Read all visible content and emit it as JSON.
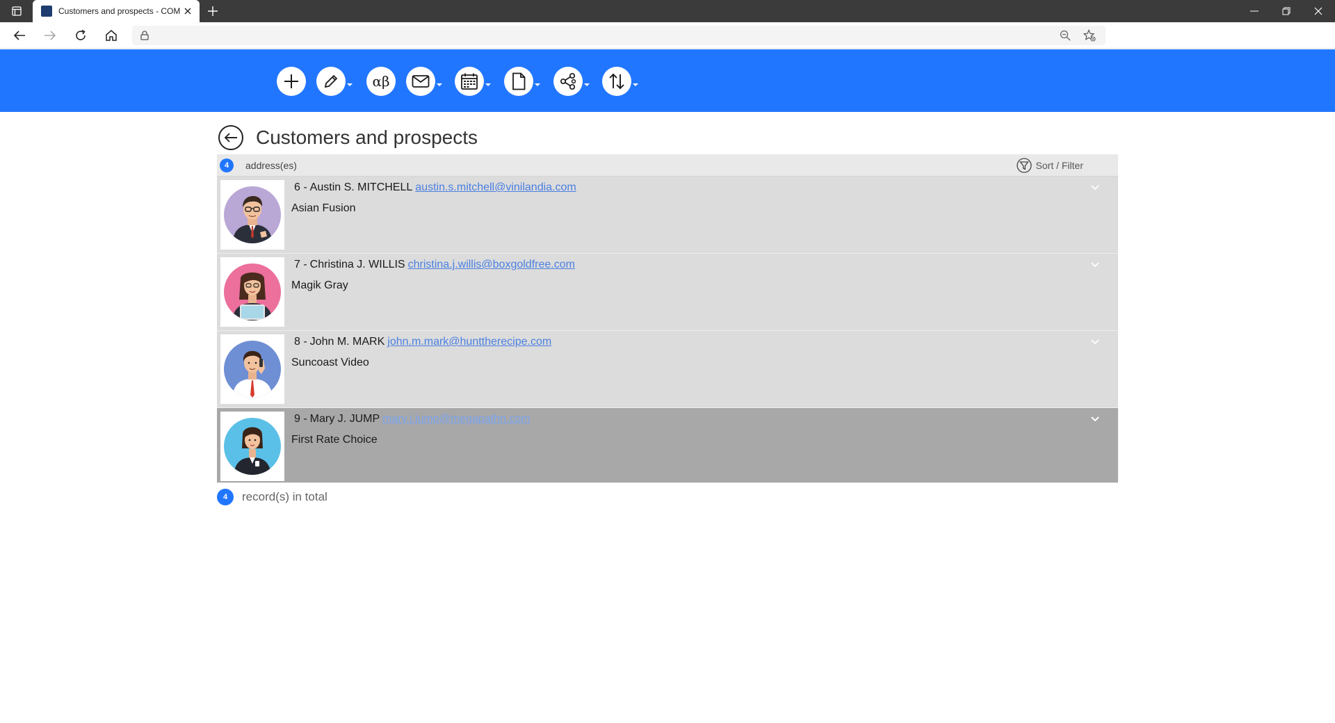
{
  "browser": {
    "tab_title": "Customers and prospects - COM",
    "url": ""
  },
  "page": {
    "title": "Customers and prospects",
    "address_count": "4",
    "address_label": "address(es)",
    "sort_filter_label": "Sort / Filter",
    "total_count": "4",
    "total_label": "record(s) in total"
  },
  "toolbar": {
    "alpha_beta_label": "αβ"
  },
  "records": [
    {
      "number": "6 -",
      "name": "Austin S. MITCHELL",
      "email": "austin.s.mitchell@vinilandia.com",
      "company": "Asian Fusion"
    },
    {
      "number": "7 -",
      "name": "Christina J. WILLIS",
      "email": "christina.j.willis@boxgoldfree.com",
      "company": "Magik Gray"
    },
    {
      "number": "8 -",
      "name": "John M. MARK",
      "email": "john.m.mark@hunttherecipe.com",
      "company": "Suncoast Video"
    },
    {
      "number": "9 -",
      "name": "Mary J. JUMP",
      "email": "mary.j.jump@megapathn.com",
      "company": "First Rate Choice"
    }
  ],
  "colors": {
    "appbar": "#2176ff",
    "row": "#dcdcdc",
    "row_selected": "#a8a8a8",
    "link": "#4a7fe0"
  },
  "icons": {
    "toolbar": [
      "plus-icon",
      "pencil-icon",
      "alpha-beta-icon",
      "mail-icon",
      "calendar-icon",
      "document-icon",
      "share-icon",
      "sort-arrows-icon"
    ]
  }
}
